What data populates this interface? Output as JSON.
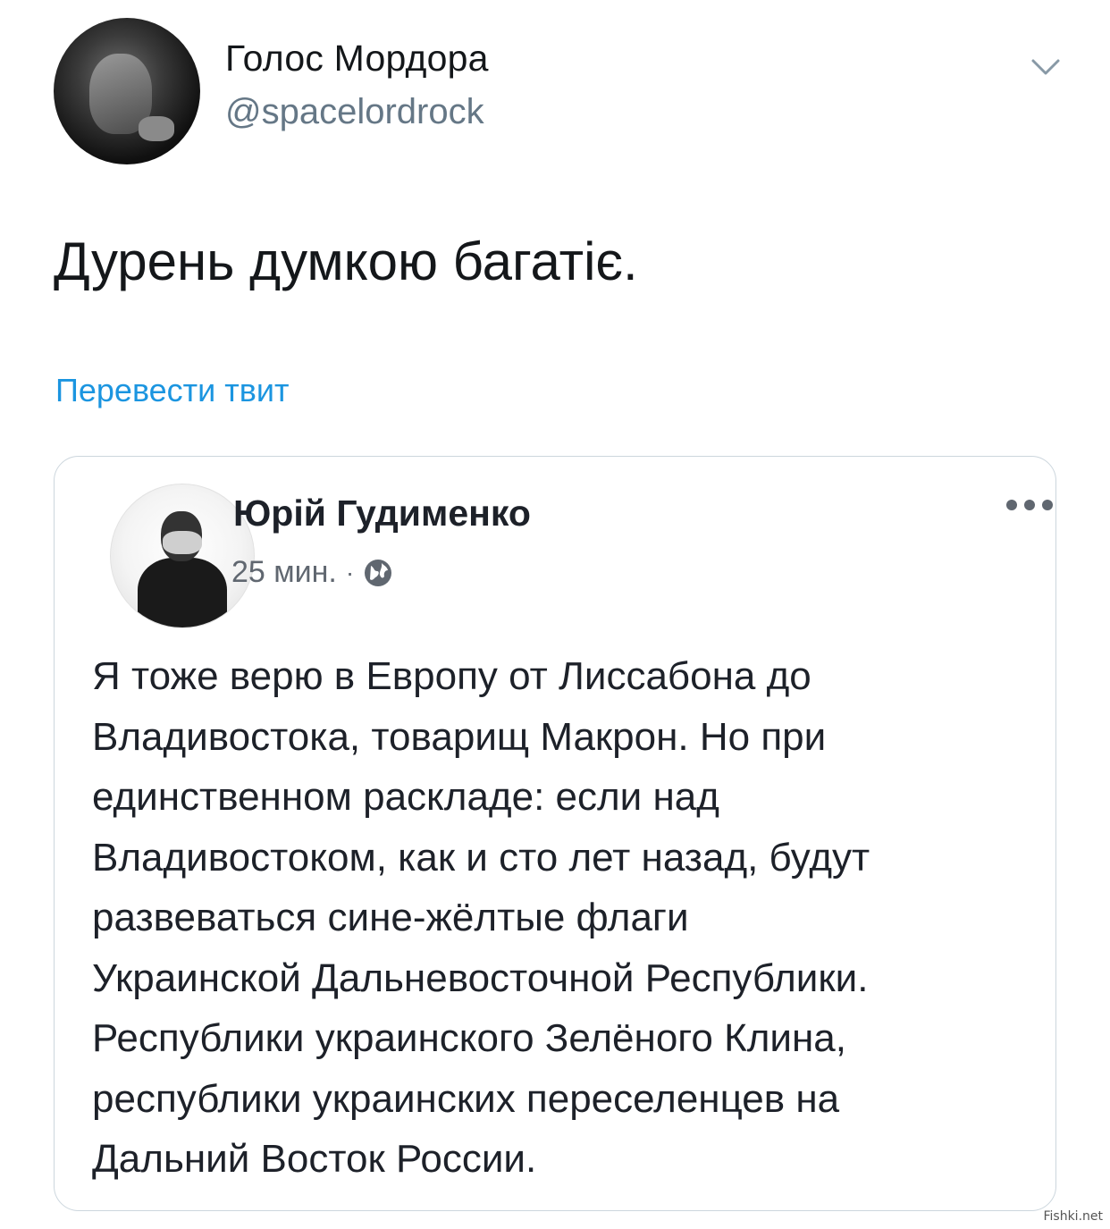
{
  "tweet": {
    "display_name": "Голос Мордора",
    "handle": "@spacelordrock",
    "text": "Дурень думкою багатіє.",
    "translate_label": "Перевести твит",
    "link_color": "#1b95e0"
  },
  "embedded_post": {
    "author": "Юрій Гудименко",
    "time": "25 мин.",
    "separator": "·",
    "privacy_icon": "globe-icon",
    "lines": [
      "Я тоже верю в Европу от Лиссабона до",
      "Владивостока, товарищ Макрон. Но при",
      "единственном раскладе: если над",
      "Владивостоком, как и сто лет назад, будут",
      "развеваться сине-жёлтые флаги",
      "Украинской Дальневосточной Республики.",
      "Республики украинского Зелёного Клина,",
      "республики украинских переселенцев на",
      "Дальний Восток России."
    ]
  },
  "watermark": "Fishki.net"
}
